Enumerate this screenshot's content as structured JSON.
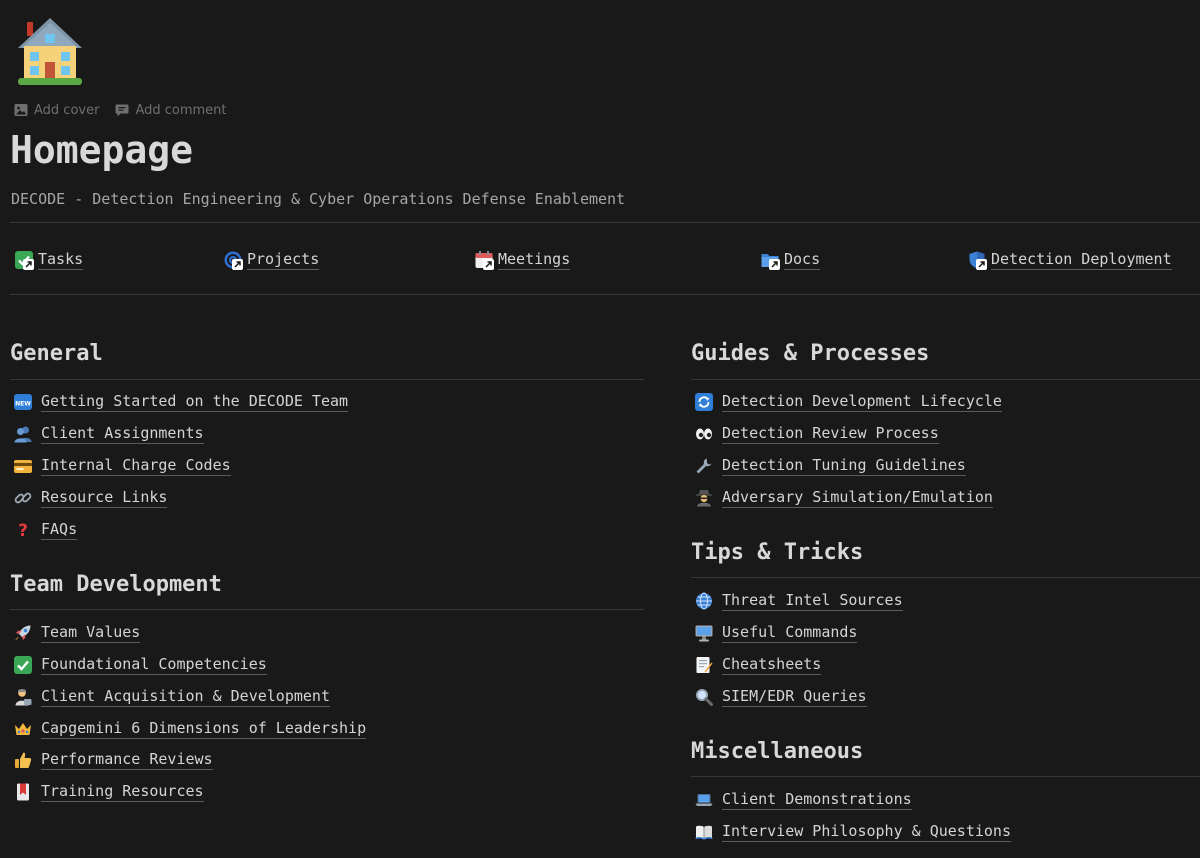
{
  "page": {
    "icon": "house-icon",
    "controls": {
      "add_cover": "Add cover",
      "add_comment": "Add comment"
    },
    "title": "Homepage",
    "subtitle": "DECODE - Detection Engineering & Cyber Operations Defense Enablement"
  },
  "quick_links": [
    {
      "label": "Tasks",
      "icon": "check-box-icon"
    },
    {
      "label": "Projects",
      "icon": "target-icon"
    },
    {
      "label": "Meetings",
      "icon": "calendar-icon"
    },
    {
      "label": "Docs",
      "icon": "folder-icon"
    },
    {
      "label": "Detection Deployment",
      "icon": "shield-icon"
    }
  ],
  "sections": {
    "general": {
      "heading": "General",
      "items": [
        {
          "label": "Getting Started on the DECODE Team",
          "icon": "new-badge-icon"
        },
        {
          "label": "Client Assignments",
          "icon": "people-icon"
        },
        {
          "label": "Internal Charge Codes",
          "icon": "credit-card-icon"
        },
        {
          "label": "Resource Links",
          "icon": "link-icon"
        },
        {
          "label": "FAQs",
          "icon": "question-mark-icon"
        }
      ]
    },
    "team_development": {
      "heading": "Team Development",
      "items": [
        {
          "label": "Team Values",
          "icon": "rocket-icon"
        },
        {
          "label": "Foundational Competencies",
          "icon": "check-mark-icon"
        },
        {
          "label": "Client Acquisition & Development",
          "icon": "office-worker-icon"
        },
        {
          "label": "Capgemini 6 Dimensions of Leadership",
          "icon": "crown-icon"
        },
        {
          "label": "Performance Reviews",
          "icon": "thumbs-up-icon"
        },
        {
          "label": "Training Resources",
          "icon": "bookmark-icon"
        }
      ]
    },
    "guides": {
      "heading": "Guides & Processes",
      "items": [
        {
          "label": "Detection Development Lifecycle",
          "icon": "cycle-arrows-icon"
        },
        {
          "label": "Detection Review Process",
          "icon": "eyes-icon"
        },
        {
          "label": "Detection Tuning Guidelines",
          "icon": "wrench-icon"
        },
        {
          "label": "Adversary Simulation/Emulation",
          "icon": "spy-icon"
        }
      ]
    },
    "tips": {
      "heading": "Tips & Tricks",
      "items": [
        {
          "label": "Threat Intel Sources",
          "icon": "globe-icon"
        },
        {
          "label": "Useful Commands",
          "icon": "desktop-icon"
        },
        {
          "label": "Cheatsheets",
          "icon": "memo-icon"
        },
        {
          "label": "SIEM/EDR Queries",
          "icon": "magnifier-icon"
        }
      ]
    },
    "misc": {
      "heading": "Miscellaneous",
      "items": [
        {
          "label": "Client Demonstrations",
          "icon": "laptop-icon"
        },
        {
          "label": "Interview Philosophy & Questions",
          "icon": "open-book-icon"
        }
      ]
    }
  }
}
